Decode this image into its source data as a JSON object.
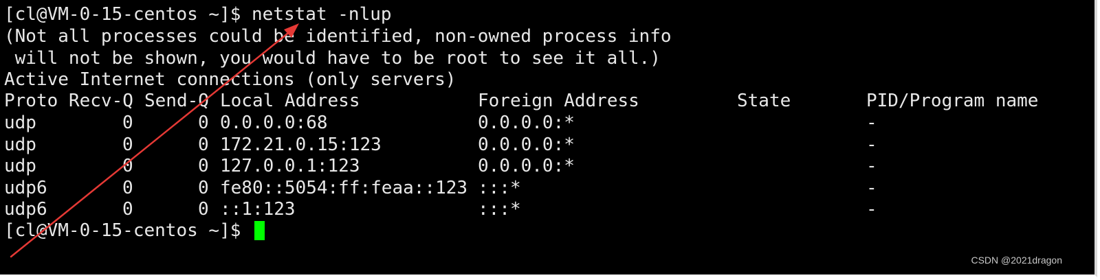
{
  "terminal": {
    "command_line": {
      "prompt": "[cl@VM-0-15-centos ~]$ ",
      "command": "netstat -nlup"
    },
    "notice": [
      "(Not all processes could be identified, non-owned process info",
      " will not be shown, you would have to be root to see it all.)"
    ],
    "section_title": "Active Internet connections (only servers)",
    "table": {
      "headers": [
        "Proto",
        "Recv-Q",
        "Send-Q",
        "Local Address",
        "Foreign Address",
        "State",
        "PID/Program name"
      ],
      "rows": [
        [
          "udp",
          "0",
          "0",
          "0.0.0.0:68",
          "0.0.0.0:*",
          "",
          "-"
        ],
        [
          "udp",
          "0",
          "0",
          "172.21.0.15:123",
          "0.0.0.0:*",
          "",
          "-"
        ],
        [
          "udp",
          "0",
          "0",
          "127.0.0.1:123",
          "0.0.0.0:*",
          "",
          "-"
        ],
        [
          "udp6",
          "0",
          "0",
          "fe80::5054:ff:feaa::123",
          ":::*",
          "",
          "-"
        ],
        [
          "udp6",
          "0",
          "0",
          "::1:123",
          ":::*",
          "",
          "-"
        ]
      ]
    },
    "final_prompt": "[cl@VM-0-15-centos ~]$ "
  },
  "colors": {
    "background": "#000000",
    "text": "#e8e8e8",
    "cursor": "#00ff00",
    "annotation_arrow": "#e53935"
  },
  "annotation": {
    "icon": "red-arrow-icon"
  },
  "watermark": "CSDN @2021dragon"
}
